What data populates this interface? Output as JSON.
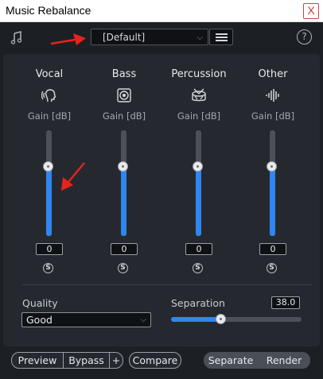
{
  "window": {
    "title": "Music Rebalance",
    "close_label": "X"
  },
  "toolbar": {
    "preset_value": "[Default]",
    "help_label": "?"
  },
  "channels": [
    {
      "name": "Vocal",
      "gain_label": "Gain [dB]",
      "value": "0",
      "solo": "S",
      "level": 0.66
    },
    {
      "name": "Bass",
      "gain_label": "Gain [dB]",
      "value": "0",
      "solo": "S",
      "level": 0.66
    },
    {
      "name": "Percussion",
      "gain_label": "Gain [dB]",
      "value": "0",
      "solo": "S",
      "level": 0.66
    },
    {
      "name": "Other",
      "gain_label": "Gain [dB]",
      "value": "0",
      "solo": "S",
      "level": 0.66
    }
  ],
  "quality": {
    "label": "Quality",
    "value": "Good"
  },
  "separation": {
    "label": "Separation",
    "value": "38.0",
    "level": 0.38
  },
  "bottom": {
    "preview": "Preview",
    "bypass": "Bypass",
    "plus": "+",
    "compare": "Compare",
    "separate": "Separate",
    "render": "Render"
  },
  "colors": {
    "accent": "#2f86f0",
    "annotation": "#e8231c",
    "background": "#1c1f24",
    "panel": "#25292f"
  }
}
